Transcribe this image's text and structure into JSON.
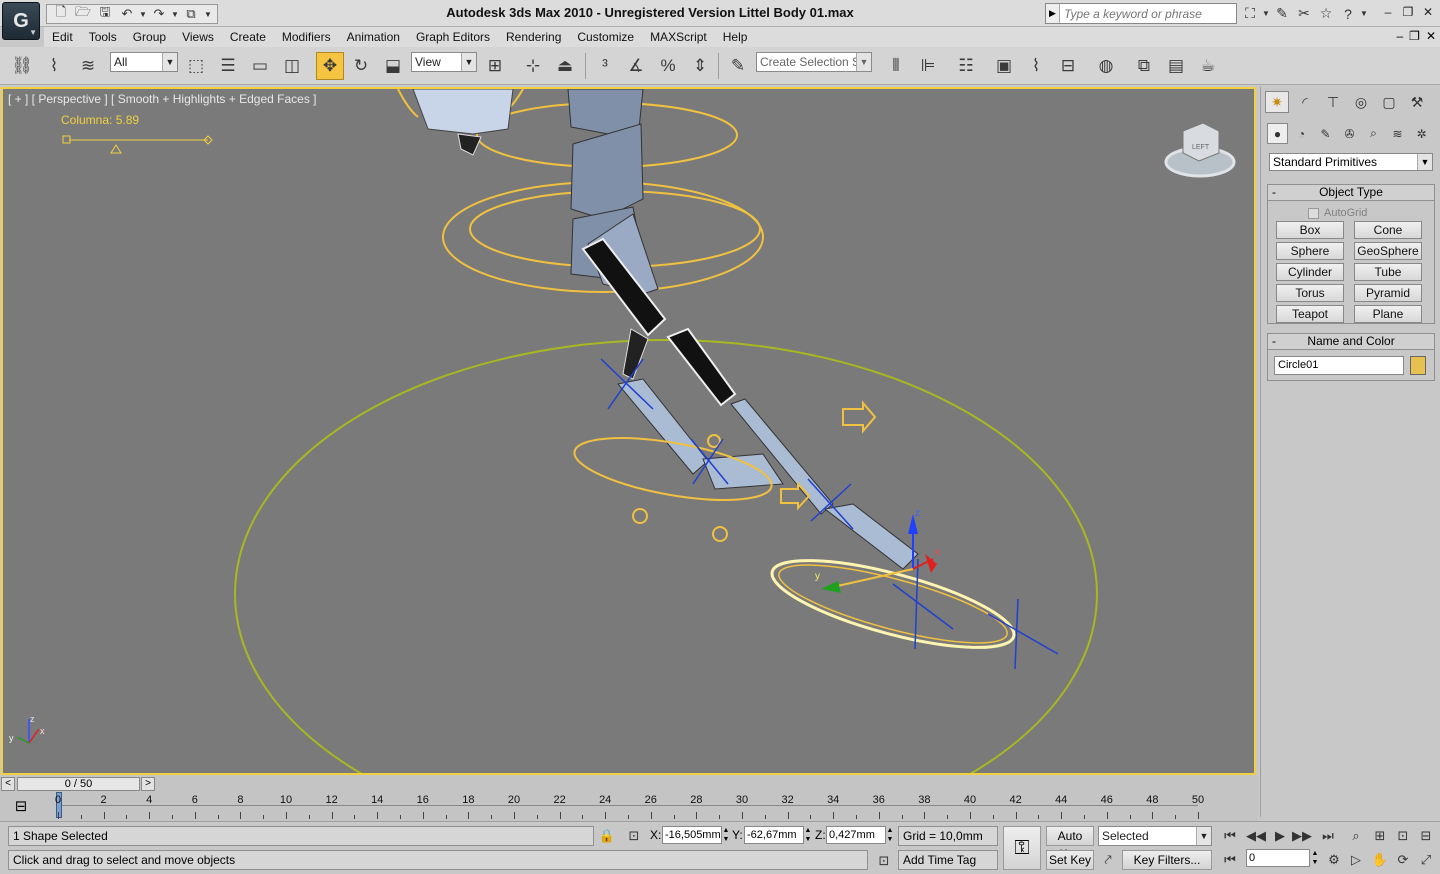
{
  "app": {
    "title": "Autodesk 3ds Max  2010   - Unregistered Version    Littel Body 01.max",
    "logo_glyph": "G",
    "search_placeholder": "Type a keyword or phrase"
  },
  "menu": [
    "Edit",
    "Tools",
    "Group",
    "Views",
    "Create",
    "Modifiers",
    "Animation",
    "Graph Editors",
    "Rendering",
    "Customize",
    "MAXScript",
    "Help"
  ],
  "toolbar": {
    "filter_value": "All",
    "coord_system": "View",
    "selection_set_placeholder": "Create Selection Se",
    "active_tool": "select-and-move"
  },
  "viewport": {
    "label": "[ + ] [ Perspective ] [ Smooth + Highlights + Edged Faces ]",
    "manipulator_label": "Columna: 5.89",
    "viewcube_face": "LEFT",
    "axis_labels": {
      "x": "x",
      "y": "y",
      "z": "z"
    },
    "colors": {
      "border_active": "#f0d040",
      "background": "#7a7a7a",
      "shape_yellow": "#f0c040",
      "shape_green": "#a8b820"
    }
  },
  "command_panel": {
    "dropdown_value": "Standard Primitives",
    "object_type_title": "Object Type",
    "autogrid_label": "AutoGrid",
    "primitives": [
      "Box",
      "Cone",
      "Sphere",
      "GeoSphere",
      "Cylinder",
      "Tube",
      "Torus",
      "Pyramid",
      "Teapot",
      "Plane"
    ],
    "name_and_color_title": "Name and Color",
    "object_name": "Circle01",
    "object_color": "#e8c050",
    "rollout_minus": "-"
  },
  "timeline": {
    "frame_display": "0 / 50",
    "prev_arrow": "<",
    "next_arrow": ">",
    "ticks": [
      0,
      2,
      4,
      6,
      8,
      10,
      12,
      14,
      16,
      18,
      20,
      22,
      24,
      26,
      28,
      30,
      32,
      34,
      36,
      38,
      40,
      42,
      44,
      46,
      48,
      50
    ]
  },
  "status": {
    "selection": "1 Shape Selected",
    "prompt": "Click and drag to select and move objects",
    "x_label": "X:",
    "x_value": "-16,505mm",
    "y_label": "Y:",
    "y_value": "-62,67mm",
    "z_label": "Z:",
    "z_value": "0,427mm",
    "grid": "Grid = 10,0mm",
    "add_time_tag": "Add Time Tag",
    "auto_key": "Auto Key",
    "set_key": "Set Key",
    "key_mode": "Selected",
    "key_filters": "Key Filters...",
    "current_frame": "0"
  }
}
